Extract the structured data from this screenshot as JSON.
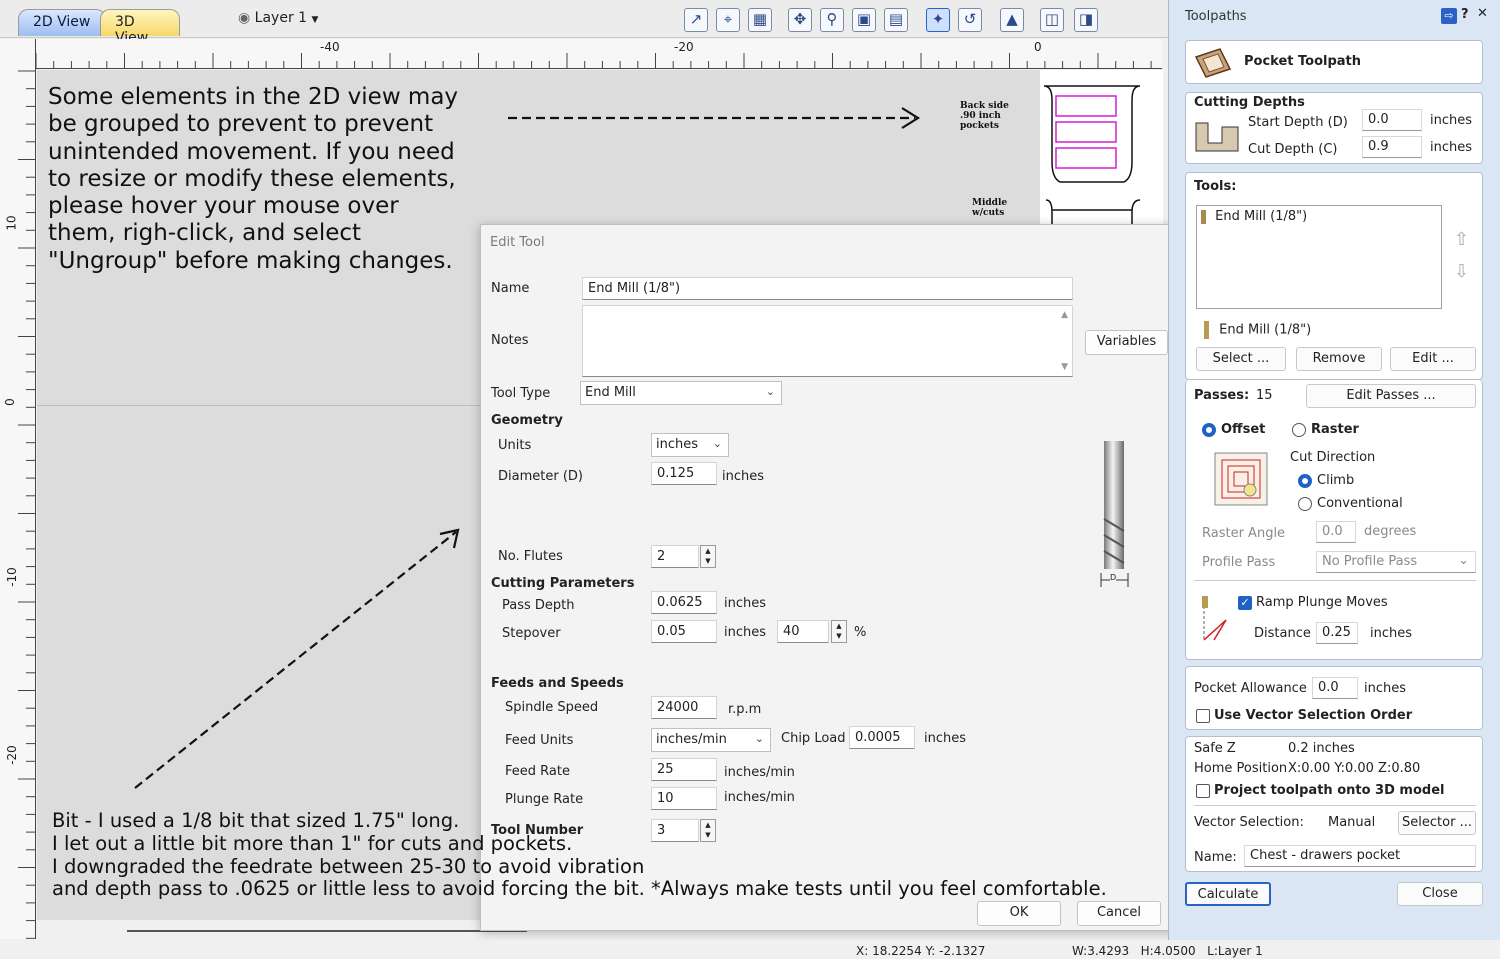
{
  "tabs": {
    "view2d": "2D View",
    "view3d": "3D View"
  },
  "layer_selector": "Layer 1",
  "ruler": {
    "labels": [
      "-40",
      "-20",
      "0"
    ],
    "vlabels": [
      "10",
      "0",
      "-10",
      "-20"
    ]
  },
  "canvas_labels": {
    "back_side": "Back side\n.90 inch pockets",
    "middle": "Middle w/cuts"
  },
  "annotations": {
    "note1": "Some elements in the 2D view may\nbe grouped to prevent to prevent\nunintended movement.  If you need\nto resize or modify these elements,\nplease hover your mouse over\nthem, righ-click, and select\n\"Ungroup\" before making changes.",
    "note2": "Bit - I used a 1/8 bit that sized 1.75\" long.\nI let out a little bit more than 1\" for cuts and pockets.\nI downgraded the feedrate between 25-30 to avoid vibration\nand depth pass to .0625 or little less to avoid forcing the bit. *Always make tests until you feel comfortable."
  },
  "status_bar": {
    "coords": "X: 18.2254 Y: -2.1327",
    "size": "W:3.4293   H:4.0500   L:Layer 1"
  },
  "edit_tool": {
    "title": "Edit Tool",
    "name_label": "Name",
    "name_value": "End Mill (1/8\")",
    "notes_label": "Notes",
    "variables_button": "Variables",
    "tool_type_label": "Tool Type",
    "tool_type_value": "End Mill",
    "geometry_header": "Geometry",
    "units_label": "Units",
    "units_value": "inches",
    "diameter_label": "Diameter (D)",
    "diameter_value": "0.125",
    "diameter_unit": "inches",
    "flutes_label": "No. Flutes",
    "flutes_value": "2",
    "cutting_header": "Cutting Parameters",
    "pass_depth_label": "Pass Depth",
    "pass_depth_value": "0.0625",
    "pass_depth_unit": "inches",
    "stepover_label": "Stepover",
    "stepover_value": "0.05",
    "stepover_unit": "inches",
    "stepover_percent": "40",
    "percent_sign": "%",
    "feeds_header": "Feeds and Speeds",
    "spindle_label": "Spindle Speed",
    "spindle_value": "24000",
    "spindle_unit": "r.p.m",
    "feed_units_label": "Feed Units",
    "feed_units_value": "inches/min",
    "chip_load_label": "Chip Load",
    "chip_load_value": "0.0005",
    "chip_load_unit": "inches",
    "feed_rate_label": "Feed Rate",
    "feed_rate_value": "25",
    "feed_rate_unit": "inches/min",
    "plunge_rate_label": "Plunge Rate",
    "plunge_rate_value": "10",
    "plunge_rate_unit": "inches/min",
    "tool_number_label": "Tool Number",
    "tool_number_value": "3",
    "diagram_label": "D",
    "ok_button": "OK",
    "cancel_button": "Cancel"
  },
  "toolpaths_panel": {
    "title": "Toolpaths",
    "toolpath_name": "Pocket Toolpath",
    "cutting_depths_header": "Cutting Depths",
    "start_depth_label": "Start Depth (D)",
    "start_depth_value": "0.0",
    "start_depth_unit": "inches",
    "cut_depth_label": "Cut Depth (C)",
    "cut_depth_value": "0.9",
    "cut_depth_unit": "inches",
    "tools_header": "Tools:",
    "tool_list": [
      "End Mill (1/8\")"
    ],
    "selected_tool": "End Mill (1/8\")",
    "select_button": "Select ...",
    "remove_button": "Remove",
    "edit_button": "Edit ...",
    "passes_label": "Passes:",
    "passes_value": "15",
    "edit_passes_button": "Edit Passes ...",
    "offset_label": "Offset",
    "raster_label": "Raster",
    "cut_direction_label": "Cut Direction",
    "climb_label": "Climb",
    "conventional_label": "Conventional",
    "raster_angle_label": "Raster Angle",
    "raster_angle_value": "0.0",
    "raster_angle_unit": "degrees",
    "profile_pass_label": "Profile Pass",
    "profile_pass_value": "No Profile Pass",
    "ramp_label": "Ramp Plunge Moves",
    "distance_label": "Distance",
    "distance_value": "0.25",
    "distance_unit": "inches",
    "pocket_allowance_label": "Pocket Allowance",
    "pocket_allowance_value": "0.0",
    "pocket_allowance_unit": "inches",
    "vector_order_label": "Use Vector Selection Order",
    "safe_z_label": "Safe Z",
    "safe_z_value": "0.2 inches",
    "home_label": "Home Position",
    "home_value": "X:0.00 Y:0.00 Z:0.80",
    "project_label": "Project toolpath onto 3D model",
    "vector_selection_label": "Vector Selection:",
    "vector_selection_value": "Manual",
    "selector_button": "Selector ...",
    "name_label": "Name:",
    "name_value": "Chest - drawers pocket",
    "calculate_button": "Calculate",
    "close_button": "Close"
  }
}
